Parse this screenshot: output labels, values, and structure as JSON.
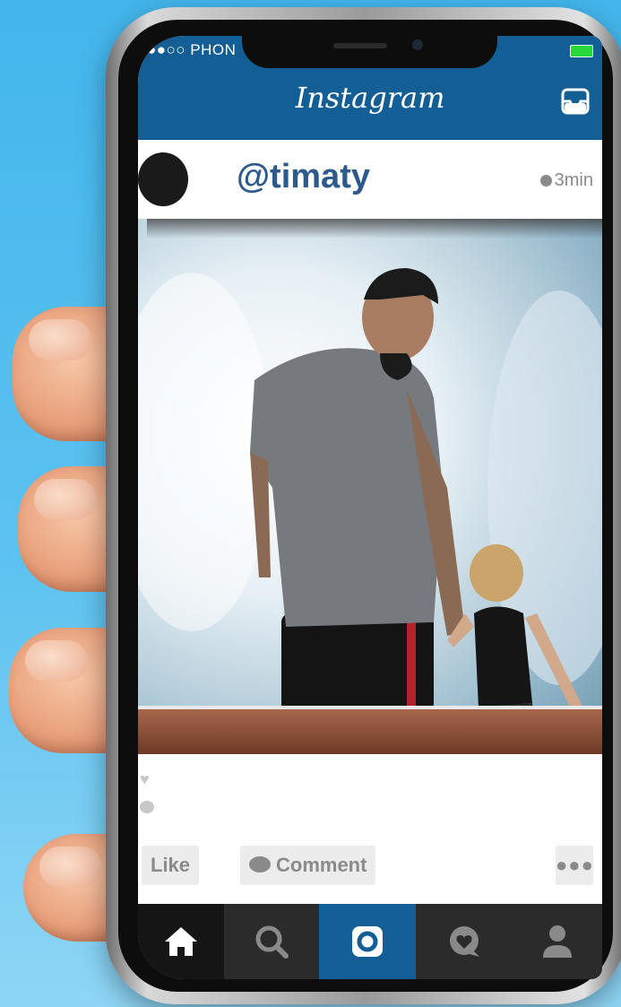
{
  "status_bar": {
    "carrier": "●●○○ PHON"
  },
  "header": {
    "title": "Instagram"
  },
  "post": {
    "username": "@timaty",
    "time": "3min"
  },
  "actions": {
    "like_label": "Like",
    "comment_label": "Comment",
    "more_label": "●●●"
  },
  "tabs": [
    "home-icon",
    "search-icon",
    "camera-icon",
    "activity-icon",
    "profile-icon"
  ],
  "colors": {
    "brand": "#135e95",
    "username": "#2c5a8c",
    "battery": "#29d93a",
    "background": "#43b6ec"
  }
}
